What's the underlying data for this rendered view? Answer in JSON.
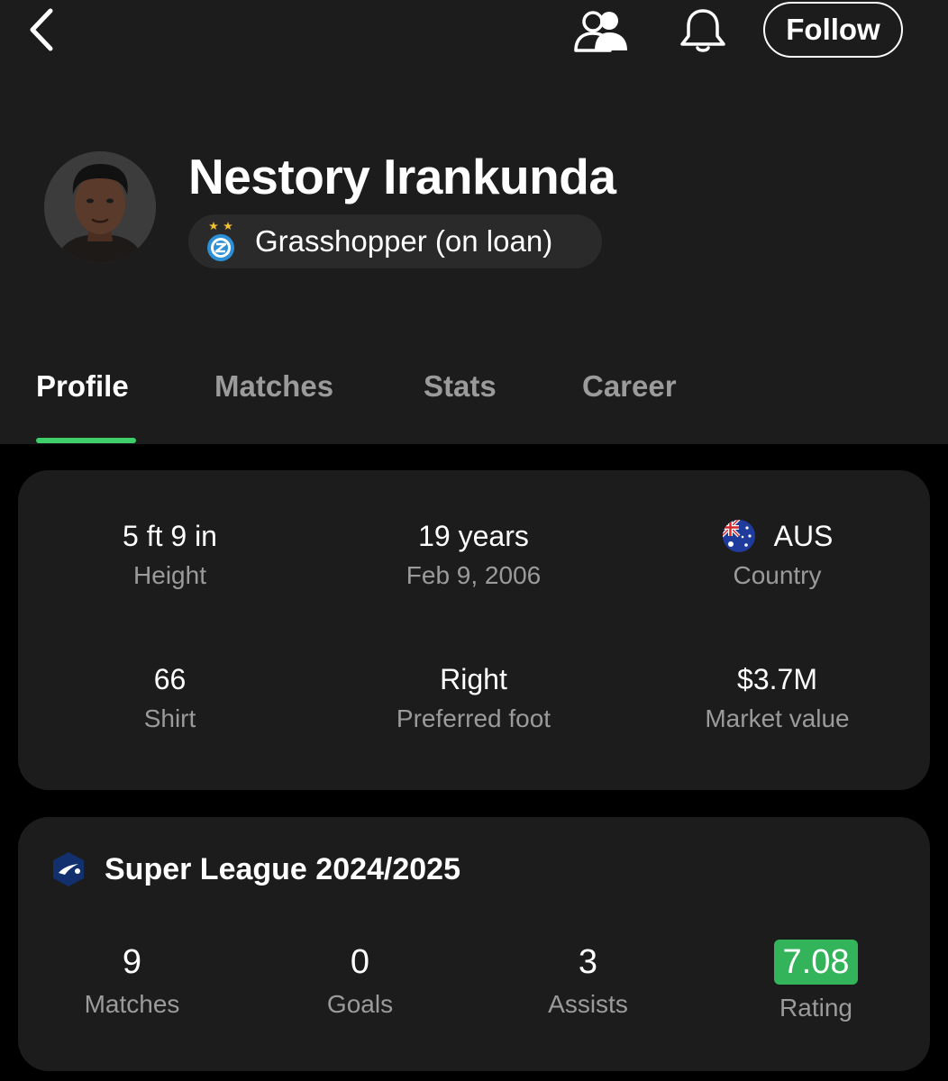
{
  "nav": {
    "back_icon": "chevron-left-icon",
    "squad_icon": "people-icon",
    "notifications_icon": "bell-icon",
    "follow_label": "Follow"
  },
  "player": {
    "name": "Nestory Irankunda",
    "team": "Grasshopper (on loan)"
  },
  "tabs": [
    {
      "label": "Profile",
      "active": true
    },
    {
      "label": "Matches",
      "active": false
    },
    {
      "label": "Stats",
      "active": false
    },
    {
      "label": "Career",
      "active": false
    }
  ],
  "info": {
    "height": {
      "value": "5 ft 9 in",
      "label": "Height"
    },
    "age": {
      "value": "19 years",
      "label": "Feb 9, 2006"
    },
    "country": {
      "value": "AUS",
      "label": "Country"
    },
    "shirt": {
      "value": "66",
      "label": "Shirt"
    },
    "foot": {
      "value": "Right",
      "label": "Preferred foot"
    },
    "market": {
      "value": "$3.7M",
      "label": "Market value"
    }
  },
  "league": {
    "title": "Super League 2024/2025",
    "stats": [
      {
        "value": "9",
        "label": "Matches"
      },
      {
        "value": "0",
        "label": "Goals"
      },
      {
        "value": "3",
        "label": "Assists"
      },
      {
        "value": "7.08",
        "label": "Rating"
      }
    ]
  },
  "colors": {
    "accent": "#3ecf6b",
    "rating_badge": "#33b35a",
    "header_bg": "#1c1c1c",
    "card_bg": "#1c1c1c",
    "page_bg": "#000000",
    "muted_text": "#9b9b9b"
  }
}
